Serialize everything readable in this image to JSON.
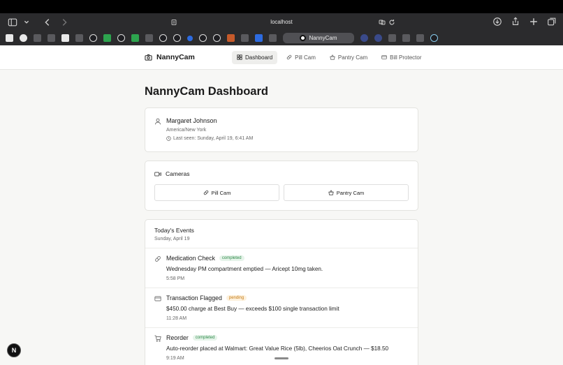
{
  "browser": {
    "url": "localhost",
    "active_tab_label": "NannyCam"
  },
  "app": {
    "brand": "NannyCam",
    "nav": [
      {
        "label": "Dashboard",
        "icon": "grid-icon",
        "active": true
      },
      {
        "label": "Pill Cam",
        "icon": "pill-icon",
        "active": false
      },
      {
        "label": "Pantry Cam",
        "icon": "basket-icon",
        "active": false
      },
      {
        "label": "Bill Protector",
        "icon": "credit-card-icon",
        "active": false
      }
    ]
  },
  "page": {
    "title": "NannyCam Dashboard"
  },
  "profile": {
    "name": "Margaret Johnson",
    "timezone": "America/New York",
    "last_seen": "Last seen: Sunday, April 19, 6:41 AM"
  },
  "cameras": {
    "heading": "Cameras",
    "buttons": [
      {
        "label": "Pill Cam",
        "icon": "pill-icon"
      },
      {
        "label": "Pantry Cam",
        "icon": "basket-icon"
      }
    ]
  },
  "events": {
    "heading": "Today's Events",
    "date": "Sunday, April 19",
    "items": [
      {
        "icon": "pill-icon",
        "title": "Medication Check",
        "status": "completed",
        "description": "Wednesday PM compartment emptied — Aricept 10mg taken.",
        "time": "5:58 PM"
      },
      {
        "icon": "credit-card-icon",
        "title": "Transaction Flagged",
        "status": "pending",
        "description": "$450.00 charge at Best Buy — exceeds $100 single transaction limit",
        "time": "11:28 AM"
      },
      {
        "icon": "cart-icon",
        "title": "Reorder",
        "status": "completed",
        "description": "Auto-reorder placed at Walmart: Great Value Rice (5lb), Cheerios Oat Crunch — $18.50",
        "time": "9:19 AM"
      }
    ]
  },
  "floating_button": "N"
}
